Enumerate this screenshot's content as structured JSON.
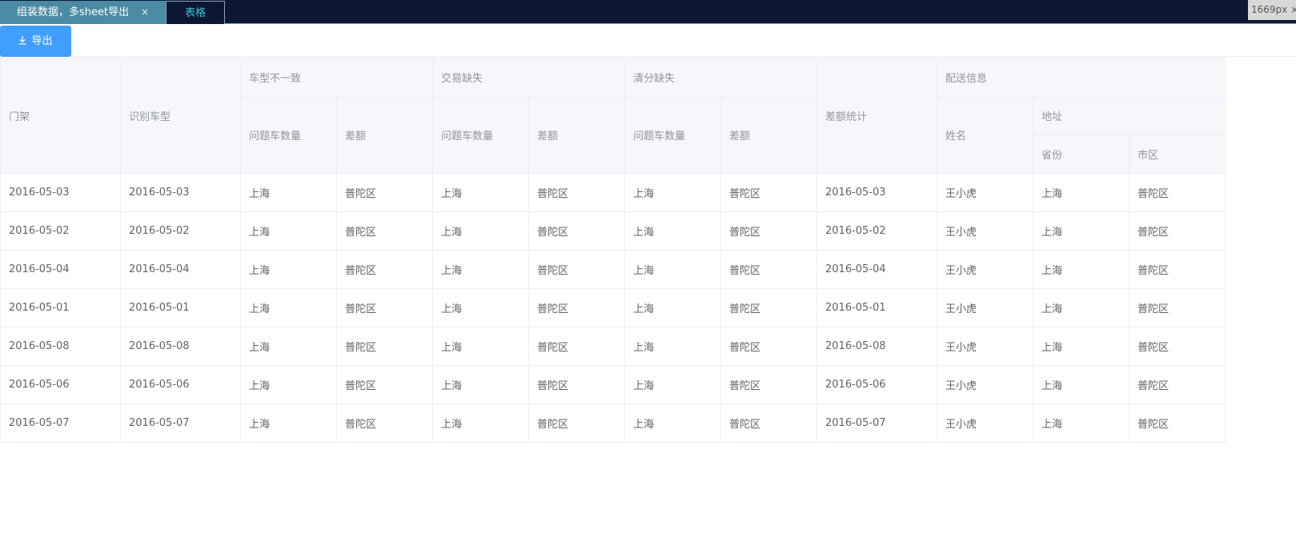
{
  "tabs": {
    "active_label": "组装数据，多sheet导出",
    "close_glyph": "×",
    "second_label": "表格"
  },
  "size_indicator": "1669px ×",
  "toolbar": {
    "export_label": "导出",
    "accent": "#409eff"
  },
  "table": {
    "headers": {
      "gantry": "门架",
      "recognized_type": "识别车型",
      "group_type_mismatch": "车型不一致",
      "group_trade_missing": "交易缺失",
      "group_clearing_missing": "清分缺失",
      "diff_stats": "差额统计",
      "group_delivery": "配送信息",
      "problem_count": "问题车数量",
      "diff": "差额",
      "name": "姓名",
      "address": "地址",
      "province": "省份",
      "city": "市区"
    },
    "rows": [
      [
        "2016-05-03",
        "2016-05-03",
        "上海",
        "普陀区",
        "上海",
        "普陀区",
        "上海",
        "普陀区",
        "2016-05-03",
        "王小虎",
        "上海",
        "普陀区"
      ],
      [
        "2016-05-02",
        "2016-05-02",
        "上海",
        "普陀区",
        "上海",
        "普陀区",
        "上海",
        "普陀区",
        "2016-05-02",
        "王小虎",
        "上海",
        "普陀区"
      ],
      [
        "2016-05-04",
        "2016-05-04",
        "上海",
        "普陀区",
        "上海",
        "普陀区",
        "上海",
        "普陀区",
        "2016-05-04",
        "王小虎",
        "上海",
        "普陀区"
      ],
      [
        "2016-05-01",
        "2016-05-01",
        "上海",
        "普陀区",
        "上海",
        "普陀区",
        "上海",
        "普陀区",
        "2016-05-01",
        "王小虎",
        "上海",
        "普陀区"
      ],
      [
        "2016-05-08",
        "2016-05-08",
        "上海",
        "普陀区",
        "上海",
        "普陀区",
        "上海",
        "普陀区",
        "2016-05-08",
        "王小虎",
        "上海",
        "普陀区"
      ],
      [
        "2016-05-06",
        "2016-05-06",
        "上海",
        "普陀区",
        "上海",
        "普陀区",
        "上海",
        "普陀区",
        "2016-05-06",
        "王小虎",
        "上海",
        "普陀区"
      ],
      [
        "2016-05-07",
        "2016-05-07",
        "上海",
        "普陀区",
        "上海",
        "普陀区",
        "上海",
        "普陀区",
        "2016-05-07",
        "王小虎",
        "上海",
        "普陀区"
      ]
    ]
  }
}
